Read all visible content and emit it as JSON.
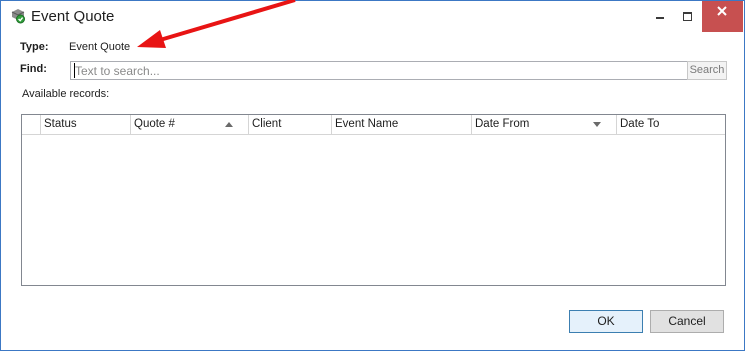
{
  "window": {
    "title": "Event Quote"
  },
  "form": {
    "type_label": "Type:",
    "type_value": "Event Quote",
    "find_label": "Find:",
    "search_placeholder": "Text to search...",
    "search_button": "Search",
    "records_label": "Available records:"
  },
  "grid": {
    "columns": [
      "",
      "Status",
      "Quote #",
      "Client",
      "Event Name",
      "Date From",
      "Date To"
    ],
    "rows": []
  },
  "buttons": {
    "ok": "OK",
    "cancel": "Cancel"
  },
  "colors": {
    "accent": "#3c78c4",
    "close_button": "#c75050",
    "annotation_arrow": "#e81414"
  }
}
